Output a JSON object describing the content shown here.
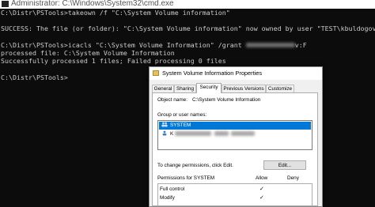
{
  "window": {
    "title": "Administrator: C:\\Windows\\System32\\cmd.exe"
  },
  "console": {
    "l1": "C:\\Distr\\PSTools>takeown /f \"C:\\System Volume information\"",
    "l3": "SUCCESS: The file (or folder): \"C:\\System Volume information\" now owned by user \"TEST\\kbuldogov\".",
    "l5a": "C:\\Distr\\PSTools>icacls \"C:\\System Volume Information\" /grant ",
    "l5b": "v:F",
    "l6": "processed file: C:\\System Volume Information",
    "l7": "Successfully processed 1 files; Failed processing 0 files",
    "l9": "C:\\Distr\\PSTools>"
  },
  "dialog": {
    "title": "System Volume Information Properties",
    "tabs": [
      "General",
      "Sharing",
      "Security",
      "Previous Versions",
      "Customize"
    ],
    "object_label": "Object name:",
    "object_value": "C:\\System Volume Information",
    "group_label": "Group or user names:",
    "users": [
      "SYSTEM",
      "K"
    ],
    "change_hint": "To change permissions, click Edit.",
    "edit_button": "Edit...",
    "perm_header": "Permissions for SYSTEM",
    "allow": "Allow",
    "deny": "Deny",
    "permissions": [
      "Full control",
      "Modify"
    ],
    "check": "✓"
  }
}
